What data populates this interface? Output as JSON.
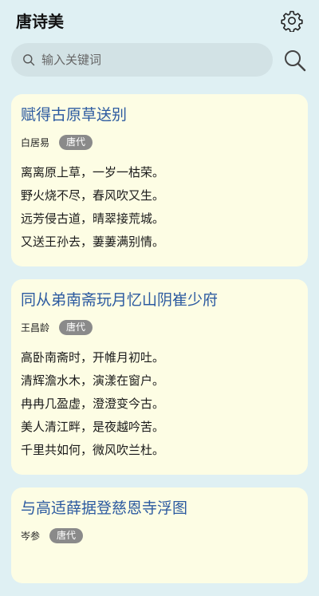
{
  "header": {
    "title": "唐诗美",
    "settings_icon": "gear-icon"
  },
  "search": {
    "placeholder": "输入关键词",
    "value": "",
    "button_icon": "search-icon"
  },
  "poems": [
    {
      "title": "赋得古原草送别",
      "author": "白居易",
      "dynasty": "唐代",
      "lines": [
        "离离原上草，一岁一枯荣。",
        "野火烧不尽，春风吹又生。",
        "远芳侵古道，晴翠接荒城。",
        "又送王孙去，萋萋满别情。"
      ]
    },
    {
      "title": "同从弟南斋玩月忆山阴崔少府",
      "author": "王昌龄",
      "dynasty": "唐代",
      "lines": [
        "高卧南斋时，开帷月初吐。",
        "清辉澹水木，演漾在窗户。",
        "冉冉几盈虚，澄澄变今古。",
        "美人清江畔，是夜越吟苦。",
        "千里共如何，微风吹兰杜。"
      ]
    },
    {
      "title": "与高适薛据登慈恩寺浮图",
      "author": "岑参",
      "dynasty": "唐代",
      "lines": []
    }
  ]
}
